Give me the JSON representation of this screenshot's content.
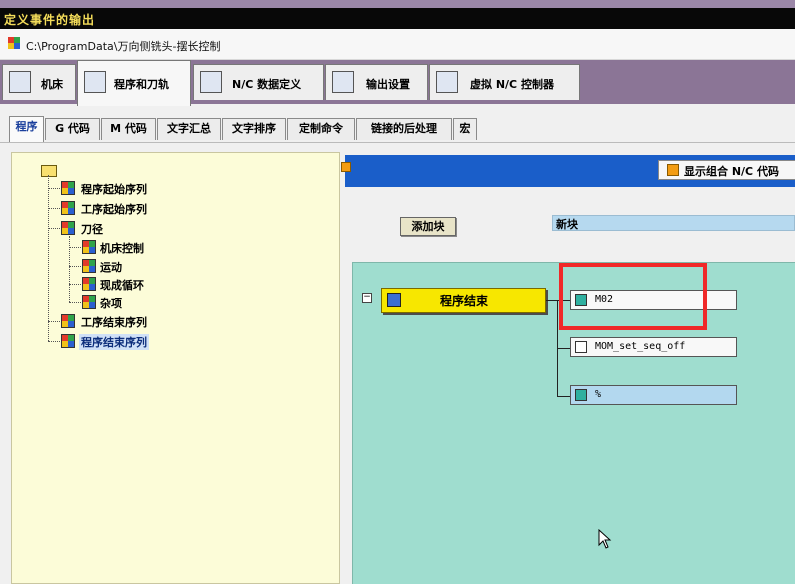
{
  "window": {
    "title": "定义事件的输出",
    "path": "C:\\ProgramData\\万向侧铣头-摆长控制"
  },
  "main_tabs": [
    {
      "label": "机床"
    },
    {
      "label": "程序和刀轨"
    },
    {
      "label": "N/C 数据定义"
    },
    {
      "label": "输出设置"
    },
    {
      "label": "虚拟 N/C 控制器"
    }
  ],
  "sub_tabs": [
    {
      "label": "程序"
    },
    {
      "label": "G 代码"
    },
    {
      "label": "M 代码"
    },
    {
      "label": "文字汇总"
    },
    {
      "label": "文字排序"
    },
    {
      "label": "定制命令"
    },
    {
      "label": "链接的后处理"
    },
    {
      "label": "宏"
    }
  ],
  "tree": {
    "items": [
      {
        "label": "程序起始序列"
      },
      {
        "label": "工序起始序列"
      },
      {
        "label": "刀径"
      },
      {
        "label": "机床控制"
      },
      {
        "label": "运动"
      },
      {
        "label": "现成循环"
      },
      {
        "label": "杂项"
      },
      {
        "label": "工序结束序列"
      },
      {
        "label": "程序结束序列"
      }
    ]
  },
  "editor": {
    "display_combo_label": "显示组合 N/C 代码",
    "add_block_label": "添加块",
    "new_block_label": "新块",
    "event_label": "程序结束",
    "blocks": [
      {
        "text": "M02"
      },
      {
        "text": "MOM_set_seq_off"
      },
      {
        "text": "%"
      }
    ]
  },
  "colors": {
    "title_text": "#f4dd5a",
    "tab_bar": "#8b7596",
    "header_blue": "#1a5ec9",
    "canvas": "#9fddcf",
    "event_node": "#f7e700",
    "highlight_box": "#f02828"
  }
}
